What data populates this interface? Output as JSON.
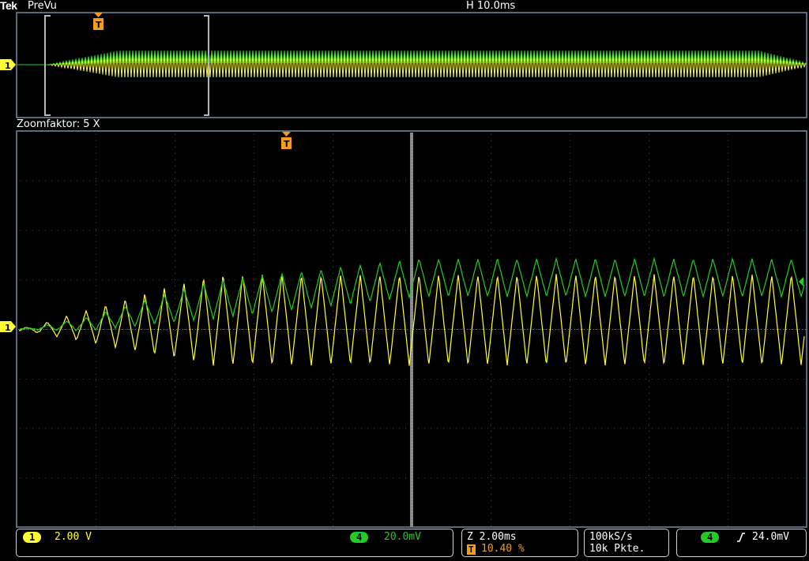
{
  "header": {
    "brand": "Tek",
    "mode": "PreVu",
    "horizontal_scale": "H 10.0ms"
  },
  "zoom": {
    "label": "Zoomfaktor: 5 X"
  },
  "markers": {
    "channel1_ground": "1",
    "trigger": "T"
  },
  "colors": {
    "ch1": "#ffff33",
    "ch4": "#22cc22",
    "trigger": "#f39c1e",
    "frame": "#7a8aa6",
    "panel_border": "#cfd3d8"
  },
  "status": {
    "ch1_badge": "1",
    "ch1_scale": "2.00 V",
    "ch4_badge": "4",
    "ch4_scale": "20.0mV",
    "zoom_time": "Z 2.00ms",
    "trigger_badge": "T",
    "trigger_position": "10.40 %",
    "sample_rate": "100kS/s",
    "record_length": "10k Pkte.",
    "trigger_source_badge": "4",
    "trigger_slope_icon": "rising-edge-icon",
    "trigger_level": "24.0mV"
  }
}
